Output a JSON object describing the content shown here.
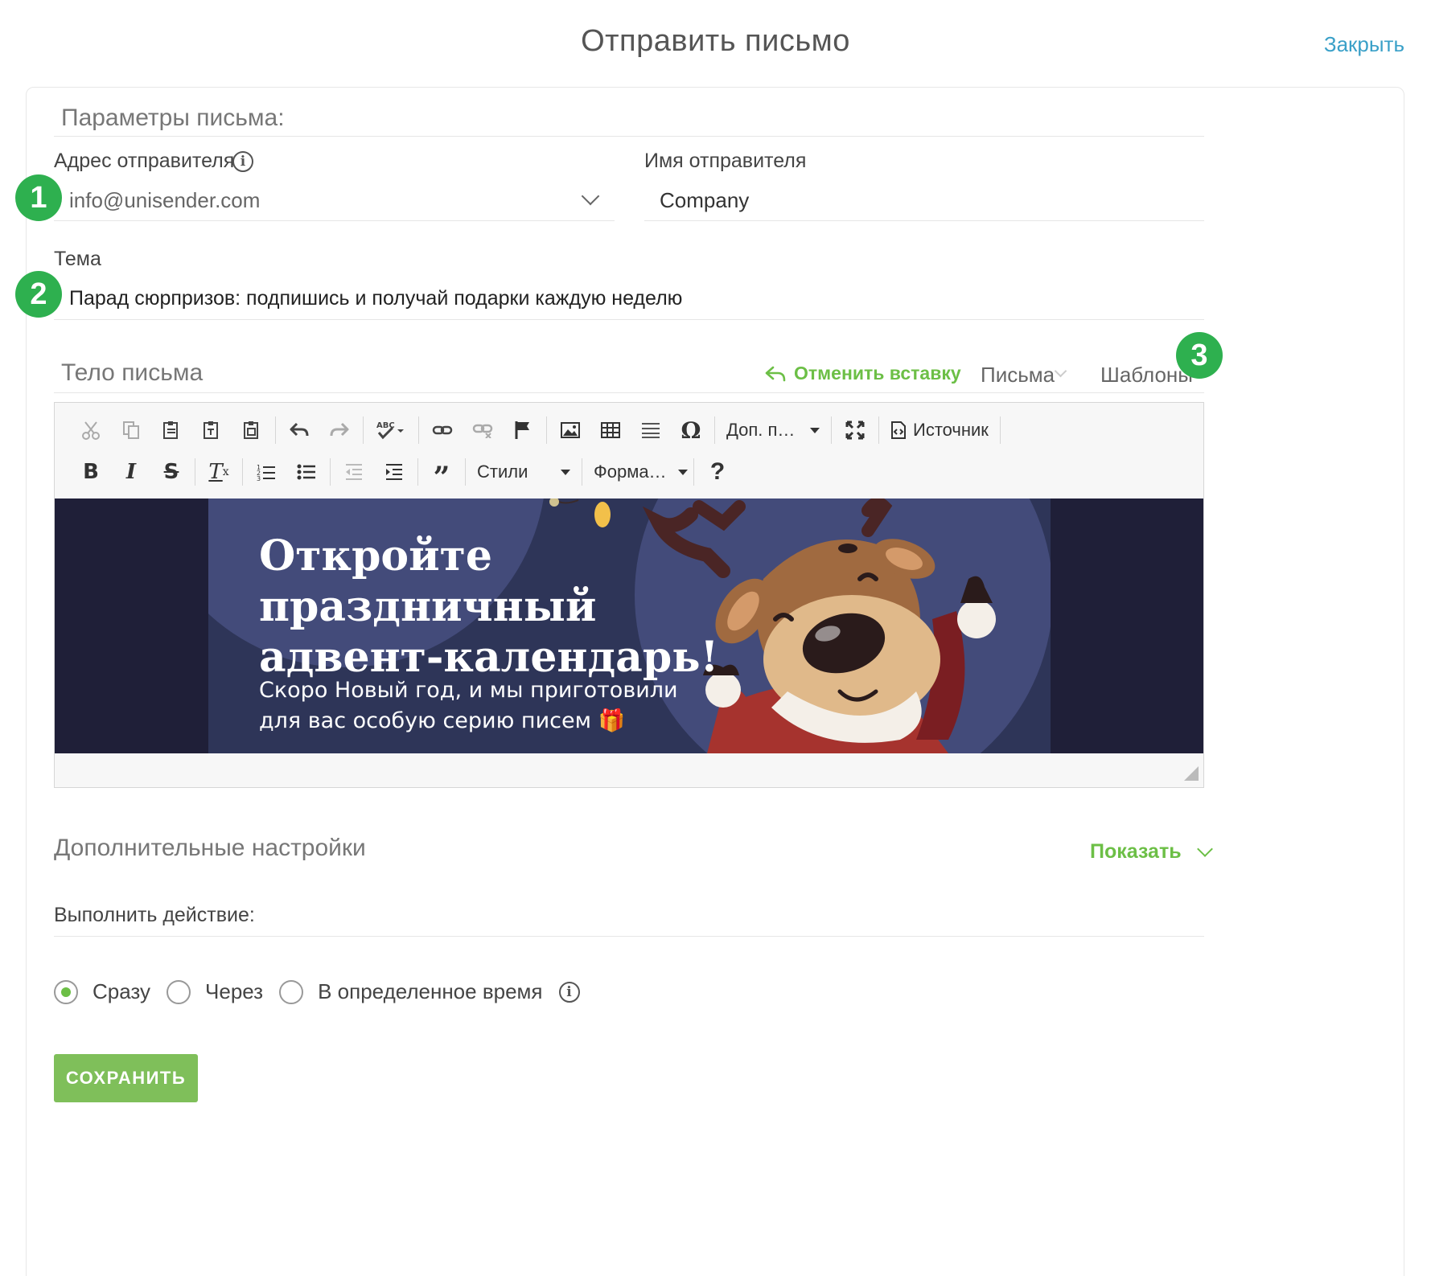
{
  "header": {
    "title": "Отправить письмо",
    "close_label": "Закрыть"
  },
  "params": {
    "section_title": "Параметры письма:",
    "sender_address_label": "Адрес отправителя",
    "sender_address_value": "info@unisender.com",
    "sender_name_label": "Имя отправителя",
    "sender_name_value": "Company",
    "subject_label": "Тема",
    "subject_value": "Парад сюрпризов: подпишись и получай подарки каждую неделю"
  },
  "badges": [
    "1",
    "2",
    "3"
  ],
  "body": {
    "section_title": "Тело письма",
    "undo_paste_label": "Отменить вставку",
    "letters_label": "Письма",
    "templates_label": "Шаблоны"
  },
  "toolbar": {
    "row1_icons": [
      "cut-icon",
      "copy-icon",
      "paste-icon",
      "paste-text-icon",
      "paste-word-icon",
      "undo-icon",
      "redo-icon",
      "spellcheck-icon",
      "link-icon",
      "unlink-icon",
      "anchor-icon",
      "image-icon",
      "table-icon",
      "horizontal-rule-icon",
      "special-char-icon",
      "maximize-icon",
      "source-icon"
    ],
    "row2_icons": [
      "bold-icon",
      "italic-icon",
      "strike-icon",
      "remove-format-icon",
      "numbered-list-icon",
      "bulleted-list-icon",
      "outdent-icon",
      "indent-icon",
      "blockquote-icon",
      "help-icon"
    ],
    "extra_combo": "Доп. п…",
    "source_label": "Источник",
    "styles_combo": "Стили",
    "format_combo": "Форма…"
  },
  "banner": {
    "title": "Откройте\nпраздничный\nадвент-календарь!",
    "subtitle": "Скоро Новый год, и мы приготовили\nдля вас особую серию писем 🎁",
    "colors": {
      "outer_bg": "#1f1f38",
      "banner_bg": "#2e3558",
      "circle": "#434b7a",
      "deer_brown": "#a06a40",
      "deer_face": "#e0b98a"
    }
  },
  "advanced": {
    "section_title": "Дополнительные настройки",
    "show_label": "Показать",
    "action_label": "Выполнить действие:",
    "options": [
      "Сразу",
      "Через",
      "В определенное время"
    ],
    "selected_option": "Сразу"
  },
  "save_label": "СОХРАНИТЬ",
  "colors": {
    "accent_green": "#6cbf46",
    "badge_green": "#2eb04f",
    "link_blue": "#3aa0c8",
    "save_button": "#7fbf5a"
  }
}
